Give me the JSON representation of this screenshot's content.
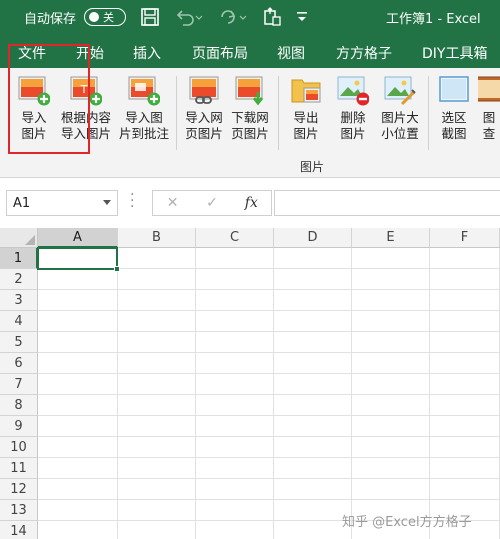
{
  "titlebar": {
    "autosave_label": "自动保存",
    "autosave_state": "关",
    "doc_title": "工作簿1  -  Excel",
    "icons": [
      "save-icon",
      "undo-icon",
      "redo-icon",
      "touch-mode-icon",
      "customize-toolbar-icon"
    ]
  },
  "ribbon_tabs": [
    "文件",
    "开始",
    "插入",
    "页面布局",
    "视图",
    "方方格子",
    "DIY工具箱"
  ],
  "ribbon_buttons": [
    {
      "line1": "导入",
      "line2": "图片"
    },
    {
      "line1": "根据内容",
      "line2": "导入图片"
    },
    {
      "line1": "导入图",
      "line2": "片到批注"
    },
    {
      "line1": "导入网",
      "line2": "页图片"
    },
    {
      "line1": "下载网",
      "line2": "页图片"
    },
    {
      "line1": "导出",
      "line2": "图片"
    },
    {
      "line1": "删除",
      "line2": "图片"
    },
    {
      "line1": "图片大",
      "line2": "小位置"
    },
    {
      "line1": "选区",
      "line2": "截图"
    },
    {
      "line1": "图",
      "line2": "查"
    }
  ],
  "ribbon_group_label": "图片",
  "formula_bar": {
    "name_box": "A1",
    "cancel": "✕",
    "enter": "✓",
    "fx": "fx",
    "content": ""
  },
  "grid": {
    "columns": [
      "A",
      "B",
      "C",
      "D",
      "E",
      "F"
    ],
    "rows": [
      "1",
      "2",
      "3",
      "4",
      "5",
      "6",
      "7",
      "8",
      "9",
      "10",
      "11",
      "12",
      "13",
      "14"
    ],
    "active_cell": "A1"
  },
  "watermark": "知乎 @Excel方方格子",
  "colors": {
    "excel_green": "#217346",
    "highlight_red": "#e0262a"
  }
}
